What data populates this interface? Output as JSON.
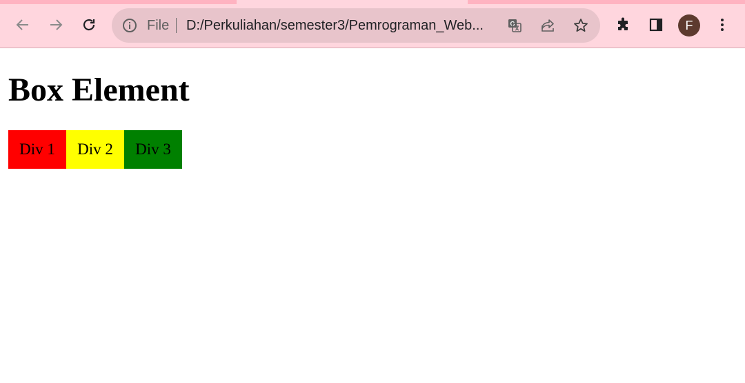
{
  "browser": {
    "url_scheme": "File",
    "url": "D:/Perkuliahan/semester3/Pemrograman_Web...",
    "profile_initial": "F",
    "icons": {
      "back": "back-arrow-icon",
      "forward": "forward-arrow-icon",
      "reload": "reload-icon",
      "site_info": "info-icon",
      "translate": "translate-icon",
      "share": "share-icon",
      "bookmark": "star-icon",
      "extensions": "puzzle-icon",
      "side_panel": "side-panel-icon",
      "menu": "kebab-menu-icon"
    },
    "colors": {
      "tab_strip": "#ffb3c1",
      "toolbar": "#ffd6de",
      "omnibox": "#e8c4cb",
      "avatar": "#5d3a2e"
    }
  },
  "page": {
    "heading": "Box Element",
    "boxes": [
      {
        "label": "Div 1",
        "color": "#ff0000"
      },
      {
        "label": "Div 2",
        "color": "#ffff00"
      },
      {
        "label": "Div 3",
        "color": "#008000"
      }
    ]
  }
}
